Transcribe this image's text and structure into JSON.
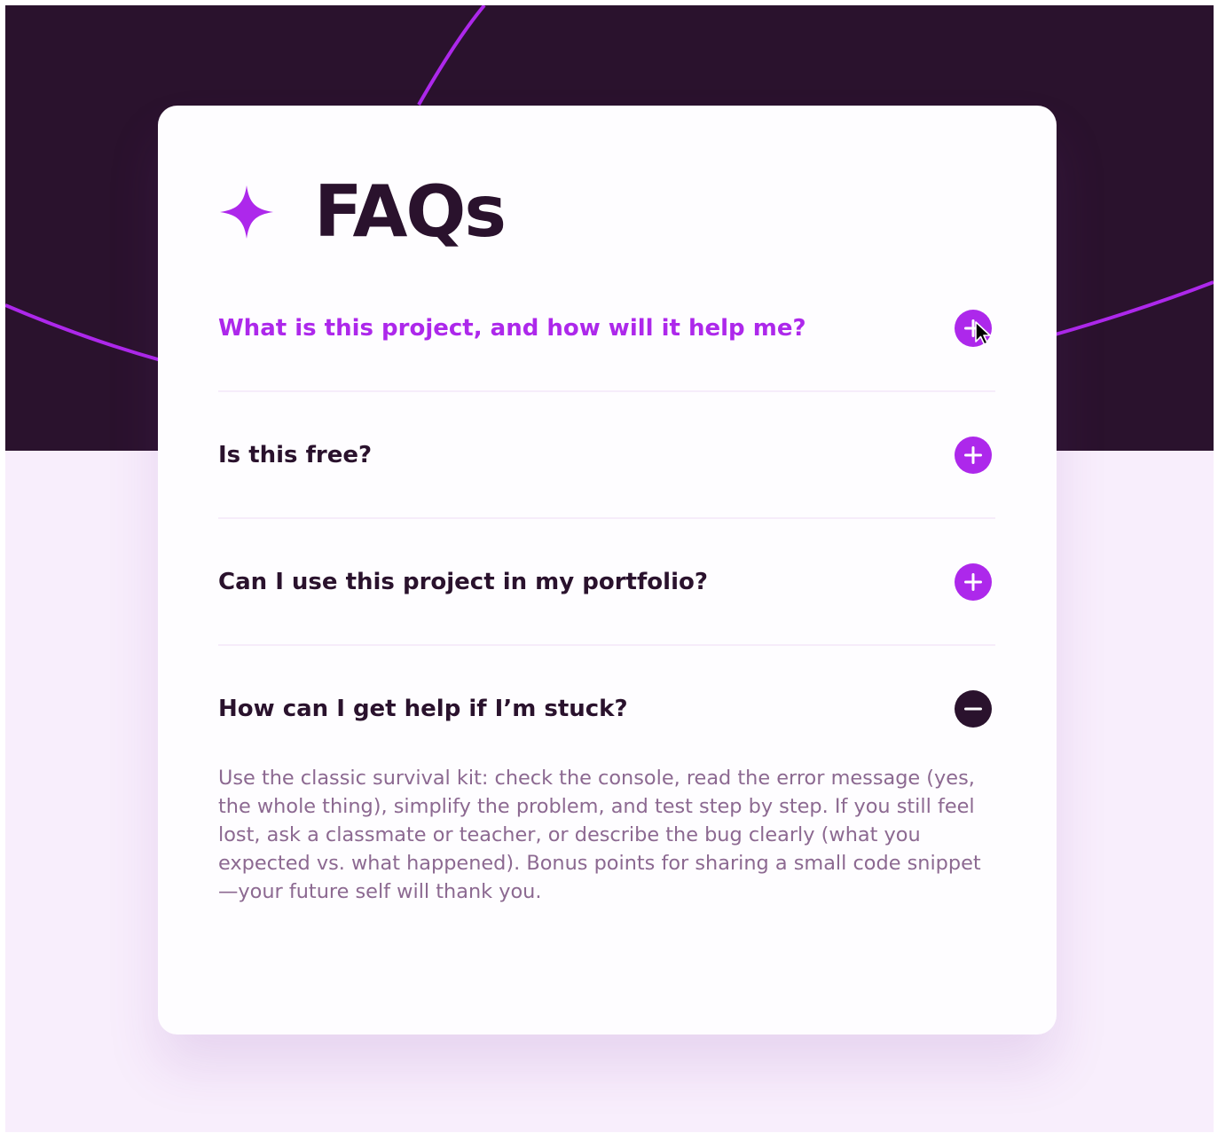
{
  "page": {
    "title": "FAQs",
    "header_icon": "star-icon",
    "colors": {
      "accent": "#ad28eb",
      "dark": "#2a122d",
      "answer_text": "#8c6991",
      "lower_background": "#f8eefc"
    }
  },
  "faqs": [
    {
      "question": "What is this project, and how will it help me?",
      "state": "collapsed",
      "hovered": true,
      "icon": "plus-icon"
    },
    {
      "question": "Is this free?",
      "state": "collapsed",
      "icon": "plus-icon"
    },
    {
      "question": "Can I use this project in my portfolio?",
      "state": "collapsed",
      "icon": "plus-icon"
    },
    {
      "question": "How can I get help if I’m stuck?",
      "state": "expanded",
      "icon": "minus-icon",
      "answer": "Use the classic survival kit: check the console, read the error message (yes, the whole thing), simplify the problem, and test step by step. If you still feel lost, ask a classmate or teacher, or describe the bug clearly (what you expected vs. what happened). Bonus points for sharing a small code snippet—your future self will thank you."
    }
  ]
}
